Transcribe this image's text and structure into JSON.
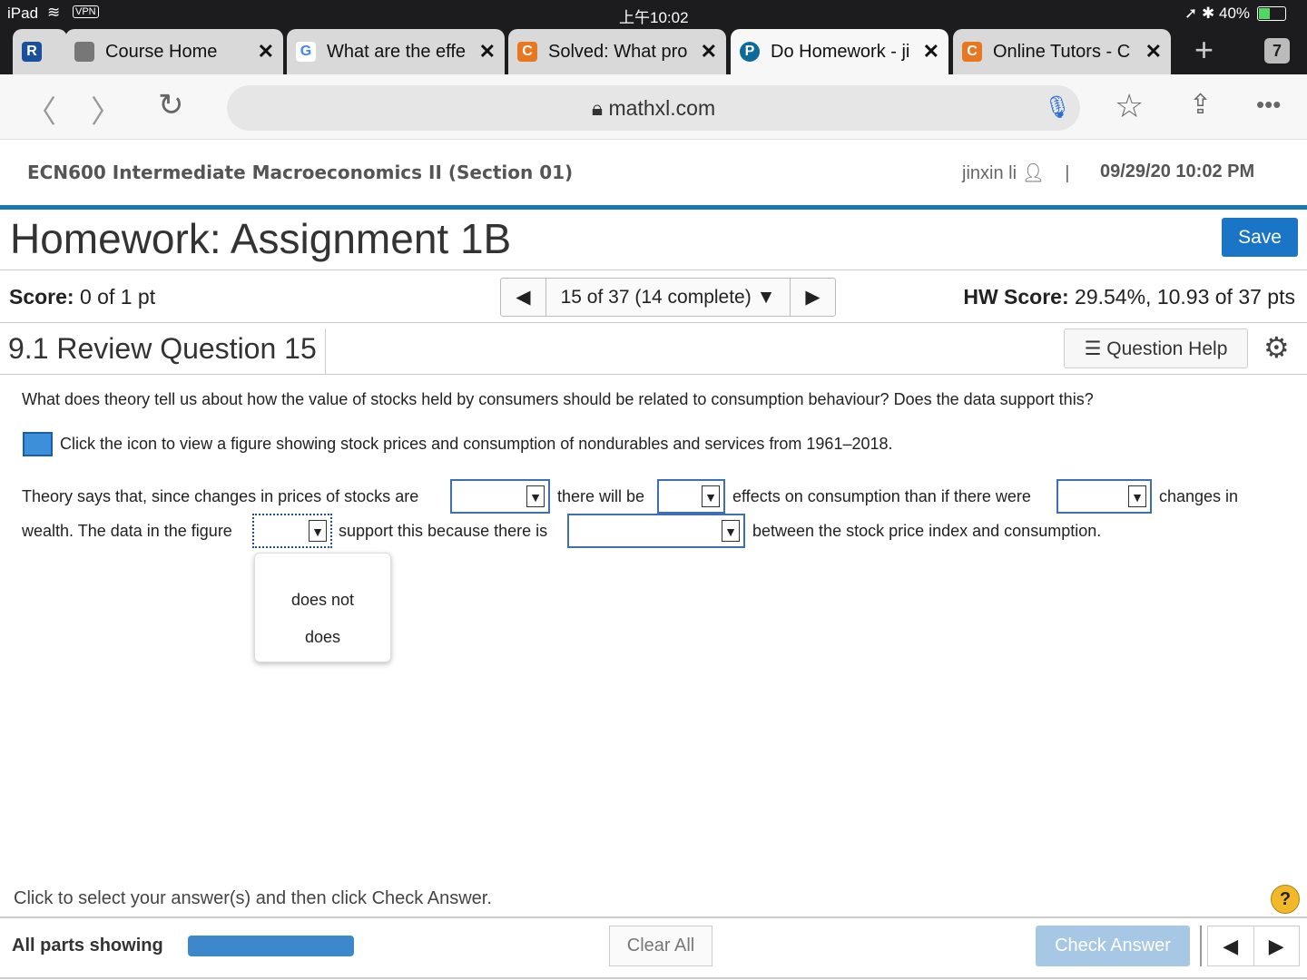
{
  "status": {
    "device": "iPad",
    "vpn": "VPN",
    "time": "上午10:02",
    "battery": "40%"
  },
  "tabs": [
    {
      "label": "Course Home",
      "icon": "tablet-icon",
      "active": false
    },
    {
      "label": "What are the effe",
      "icon": "google-icon",
      "active": false
    },
    {
      "label": "Solved: What pro",
      "icon": "chegg-icon",
      "active": false
    },
    {
      "label": "Do Homework - ji",
      "icon": "pearson-icon",
      "active": true
    },
    {
      "label": "Online Tutors - C",
      "icon": "chegg-icon",
      "active": false
    }
  ],
  "tab_count": "7",
  "url": "mathxl.com",
  "header": {
    "course": "ECN600 Intermediate Macroeconomics II (Section 01)",
    "user": "jinxin li",
    "separator": "|",
    "datetime": "09/29/20 10:02 PM"
  },
  "title": "Homework: Assignment 1B",
  "save_label": "Save",
  "score": {
    "label": "Score:",
    "value": "0 of 1 pt"
  },
  "pager": {
    "label": "15 of 37 (14 complete)"
  },
  "hw_score": {
    "label": "HW Score:",
    "value": "29.54%, 10.93 of 37 pts"
  },
  "question": {
    "title": "9.1 Review Question 15",
    "help_label": "Question Help",
    "prompt": "What does theory tell us about how the value of stocks held by consumers should be related to consumption behaviour? Does the data support this?",
    "figure_text": "Click the icon to view a figure showing stock prices and consumption of nondurables and services from 1961–2018.",
    "parts": [
      "Theory says that, since changes in prices of stocks are",
      "there will be",
      "effects on consumption than if there were",
      "changes in",
      "wealth. The data in the figure",
      "support this because there is",
      "between the stock price index and consumption."
    ],
    "dropdown_options": [
      "does not",
      "does"
    ]
  },
  "footer": {
    "note": "Click to select your answer(s) and then click Check Answer.",
    "parts_label": "All parts showing",
    "progress_percent": 100,
    "clear_label": "Clear All",
    "check_label": "Check Answer"
  }
}
